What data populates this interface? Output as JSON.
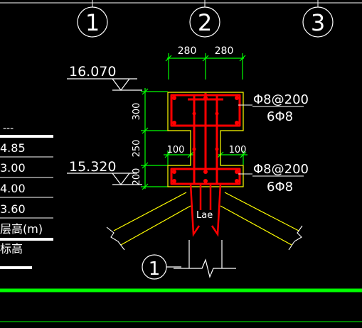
{
  "axes": [
    {
      "label": "1"
    },
    {
      "label": "2"
    },
    {
      "label": "3"
    }
  ],
  "elevations": {
    "top": "16.070",
    "bottom": "15.320"
  },
  "dimensions": {
    "width_left": "280",
    "width_right": "280",
    "height_top": "300",
    "height_mid": "250",
    "height_bottom": "200",
    "offset_left": "100",
    "offset_right": "100"
  },
  "rebar": {
    "stirrup_top": "Φ8@200",
    "long_top": "6Φ8",
    "stirrup_bottom": "Φ8@200",
    "long_bottom": "6Φ8",
    "anchorage": "Lae"
  },
  "detail_mark": "1",
  "level_table": {
    "dash_row": "---",
    "rows": [
      "4.85",
      "3.00",
      "4.00",
      "3.60"
    ],
    "header_height": "层高(m)",
    "header_elevation": "标高"
  },
  "colors": {
    "background": "#000000",
    "lines": "#ffffff",
    "rebar": "#ff0000",
    "dimension": "#00ff00",
    "concrete_outline": "#ffff00",
    "frame_green": "#00ff00"
  }
}
